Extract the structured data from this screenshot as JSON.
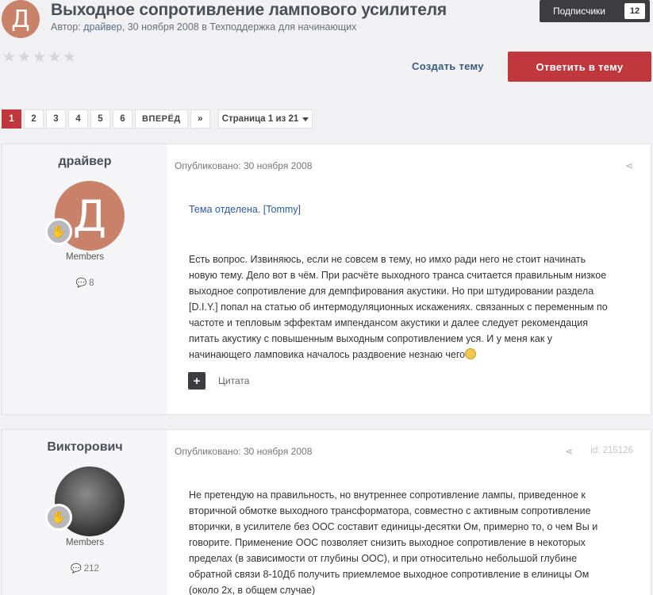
{
  "topic": {
    "avatar_letter": "Д",
    "title": "Выходное сопротивление лампового усилителя",
    "meta_prefix": "Автор:",
    "author": "драйвер",
    "sep1": ",",
    "date": "30 ноября 2008",
    "in": "в",
    "forum": "Техподдержка для начинающих",
    "rating_stars": 5,
    "rating_value": 0
  },
  "follow": {
    "label": "Подписчики",
    "count": "12"
  },
  "actions": {
    "create_topic": "Создать тему",
    "reply": "Ответить в тему"
  },
  "pagination": {
    "pages": [
      "1",
      "2",
      "3",
      "4",
      "5",
      "6"
    ],
    "active": "1",
    "next": "ВПЕРЁД",
    "last": "»",
    "jump": "Страница 1 из 21"
  },
  "posts": [
    {
      "author": "драйвер",
      "avatar_letter": "Д",
      "group": "Members",
      "post_count": "8",
      "date": "Опубликовано: 30 ноября 2008",
      "moderated_note": "Тема отделена. [Tommy]",
      "body_lines": [
        "Есть вопрос. Извиняюсь, если не совсем в тему, но имхо ради него не стоит начинать",
        "новую тему. Дело вот в чём. При расчёте выходного транса считается правильным низкое",
        "выходное сопротивление для демпфирования акустики. Но при штудировании раздела",
        "[D.I.Y.] попал на статью об интермодуляционных искажениях. связанных с переменным по",
        "частоте и тепловым эффектам импендансом акустики и далее следует рекомендация",
        "питать акустику с повышенным выходным сопротивлением уся. И у меня как у",
        "начинающего ламповика началось раздвоение незнаю чего"
      ],
      "quote_label": "Цитата"
    },
    {
      "author": "Викторович",
      "group": "Members",
      "post_count": "212",
      "date": "Опубликовано: 30 ноября 2008",
      "post_id": "id: 215126",
      "body_lines": [
        "Не претендую на правильность, но внутреннее сопротивление лампы, приведенное к",
        "вторичной обмотке выходного трансформатора, совместно с активным сопротивление",
        "вторички, в усилителе без ООС составит единицы-десятки Ом, примерно то, о чем Вы и",
        "говорите. Применение ООС позволяет снизить выходное сопротивление в некоторых",
        "пределах (в зависимости от глубины ООС), и при относительно небольшой глубине",
        "обратной связи 8-10Дб получить приемлемое выходное сопротивление в елиницы Ом",
        "(около 2х, в общем случае)"
      ]
    }
  ]
}
